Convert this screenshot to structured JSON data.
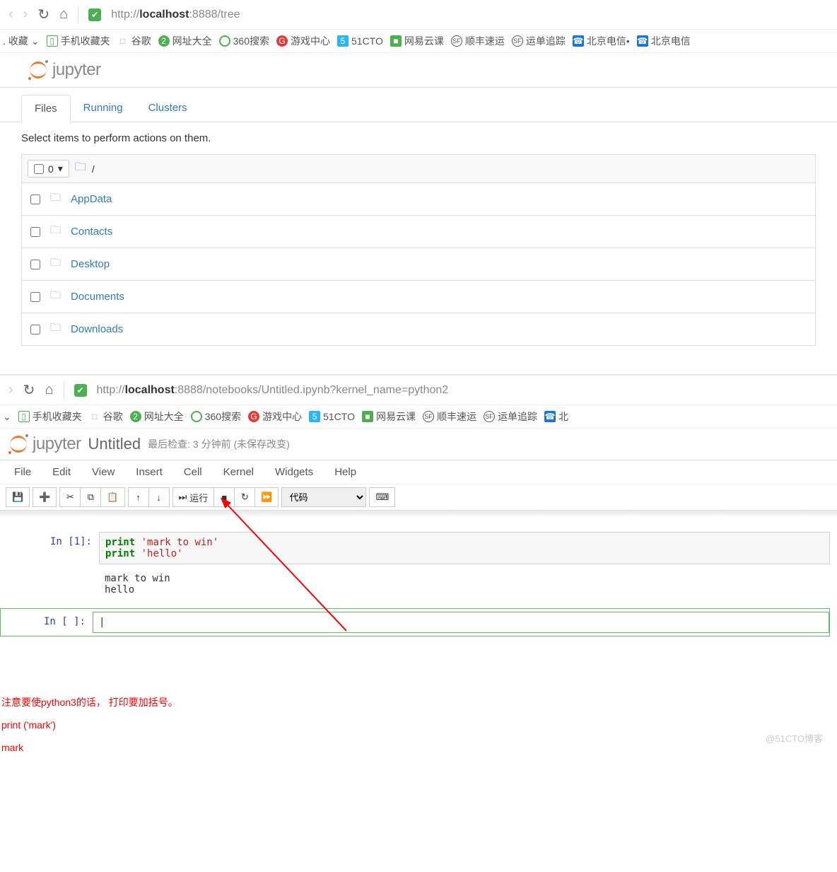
{
  "browser1": {
    "url_pre": "http://",
    "url_host": "localhost",
    "url_rest": ":8888/tree"
  },
  "bookmarks": {
    "fav": "收藏",
    "items": [
      "手机收藏夹",
      "谷歌",
      "网址大全",
      "360搜索",
      "游戏中心",
      "51CTO",
      "网易云课",
      "顺丰速运",
      "运单追踪",
      "北京电信•",
      "北京电信"
    ]
  },
  "jupyter_label": "jupyter",
  "tabs": {
    "files": "Files",
    "running": "Running",
    "clusters": "Clusters"
  },
  "tree_hint": "Select items to perform actions on them.",
  "tree_zero": "0",
  "tree_slash": "/",
  "folders": [
    "AppData",
    "Contacts",
    "Desktop",
    "Documents",
    "Downloads"
  ],
  "browser2": {
    "url_pre": "http://",
    "url_host": "localhost",
    "url_rest": ":8888/notebooks/Untitled.ipynb?kernel_name=python2"
  },
  "notebook": {
    "title": "Untitled",
    "last_check_label": "最后检查:",
    "last_check_time": "3 分钟前",
    "unsaved": "(未保存改变)"
  },
  "menu": [
    "File",
    "Edit",
    "View",
    "Insert",
    "Cell",
    "Kernel",
    "Widgets",
    "Help"
  ],
  "toolbar": {
    "run": "运行",
    "celltype": "代码"
  },
  "cell1": {
    "prompt": "In [1]:",
    "line1_kw": "print",
    "line1_str": "'mark to win'",
    "line2_kw": "print",
    "line2_str": "'hello'",
    "output": "mark to win\nhello"
  },
  "cell2": {
    "prompt": "In [ ]:"
  },
  "notes": {
    "l1": "注意要使python3的话， 打印要加括号。",
    "l2": "print ('mark')",
    "l3": "mark"
  },
  "watermark": "@51CTO博客"
}
